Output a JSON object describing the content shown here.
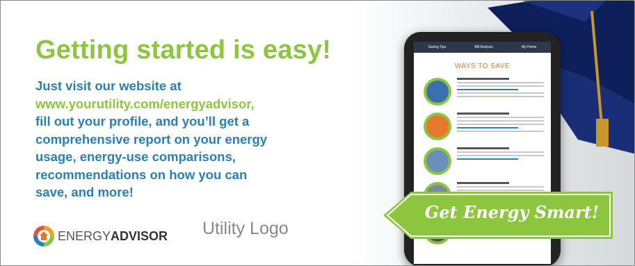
{
  "headline": "Getting started is easy!",
  "body": {
    "line1": "Just visit our website at",
    "url": "www.yourutility.com/energyadvisor,",
    "line3": "fill out your profile, and you’ll get a",
    "line4": "comprehensive report on your energy",
    "line5": "usage, energy-use comparisons,",
    "line6": "recommendations on how you can",
    "line7": "save, and more!"
  },
  "energy_advisor_logo": {
    "word1": "ENERGY",
    "word2": "ADVISOR",
    "icon": "house-icon"
  },
  "utility_logo": "Utility Logo",
  "tablet": {
    "nav": [
      "Saving Tips",
      "Bill Analysis",
      "My Home"
    ],
    "title": "WAYS TO SAVE"
  },
  "ribbon": "Get Energy Smart!",
  "colors": {
    "green": "#8cc63f",
    "blue": "#2a7fb8",
    "orange": "#e8762c"
  }
}
